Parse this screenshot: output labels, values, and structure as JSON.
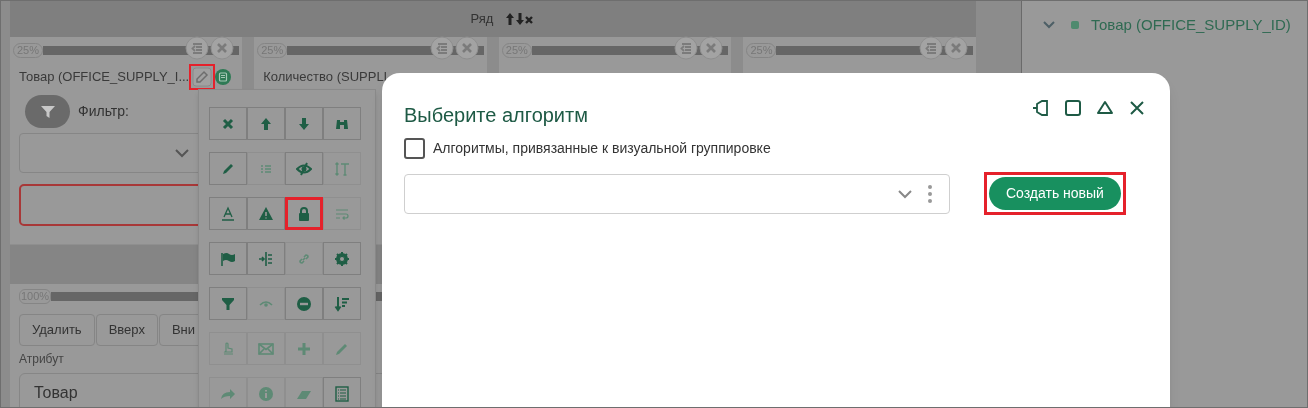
{
  "row_header": {
    "label": "Ряд"
  },
  "cards": [
    {
      "width_label": "25%",
      "title": "Товар (OFFICE_SUPPLY_I...",
      "edit_highlighted": true
    },
    {
      "width_label": "25%",
      "title": "Количество (SUPPLI"
    },
    {
      "width_label": "25%"
    },
    {
      "width_label": "25%"
    }
  ],
  "filter": {
    "label": "Фильтр:"
  },
  "section": {
    "width_label": "100%",
    "buttons": [
      "Удалить",
      "Вверх",
      "Вни"
    ],
    "attribute_label": "Атрибут",
    "attribute_value": "Товар"
  },
  "tree": {
    "label": "Товар (OFFICE_SUPPLY_ID)",
    "expanded": true,
    "color": "#4f8a6e"
  },
  "action_menu": {
    "items": [
      {
        "disabled": false,
        "highlighted": false
      },
      {
        "disabled": false,
        "highlighted": false
      },
      {
        "disabled": false,
        "highlighted": false
      },
      {
        "disabled": false,
        "highlighted": false
      },
      {
        "disabled": false,
        "highlighted": false
      },
      {
        "disabled": true,
        "highlighted": false
      },
      {
        "disabled": false,
        "highlighted": false
      },
      {
        "disabled": true,
        "highlighted": false
      },
      {
        "disabled": false,
        "highlighted": false
      },
      {
        "disabled": false,
        "highlighted": false
      },
      {
        "disabled": false,
        "highlighted": true
      },
      {
        "disabled": true,
        "highlighted": false
      },
      {
        "disabled": false,
        "highlighted": false
      },
      {
        "disabled": false,
        "highlighted": false
      },
      {
        "disabled": true,
        "highlighted": false
      },
      {
        "disabled": false,
        "highlighted": false
      },
      {
        "disabled": false,
        "highlighted": false
      },
      {
        "disabled": true,
        "highlighted": false
      },
      {
        "disabled": false,
        "highlighted": false
      },
      {
        "disabled": false,
        "highlighted": false
      },
      {
        "disabled": true,
        "highlighted": false
      },
      {
        "disabled": true,
        "highlighted": false
      },
      {
        "disabled": true,
        "highlighted": false
      },
      {
        "disabled": true,
        "highlighted": false
      },
      {
        "disabled": true,
        "highlighted": false
      },
      {
        "disabled": true,
        "highlighted": false
      },
      {
        "disabled": true,
        "highlighted": false
      },
      {
        "disabled": false,
        "highlighted": false
      }
    ]
  },
  "dialog": {
    "title": "Выберите алгоритм",
    "checkbox": {
      "label": "Алгоритмы, привязанные к визуальной группировке",
      "checked": false
    },
    "create_button": {
      "label": "Создать новый",
      "highlighted": true
    }
  }
}
